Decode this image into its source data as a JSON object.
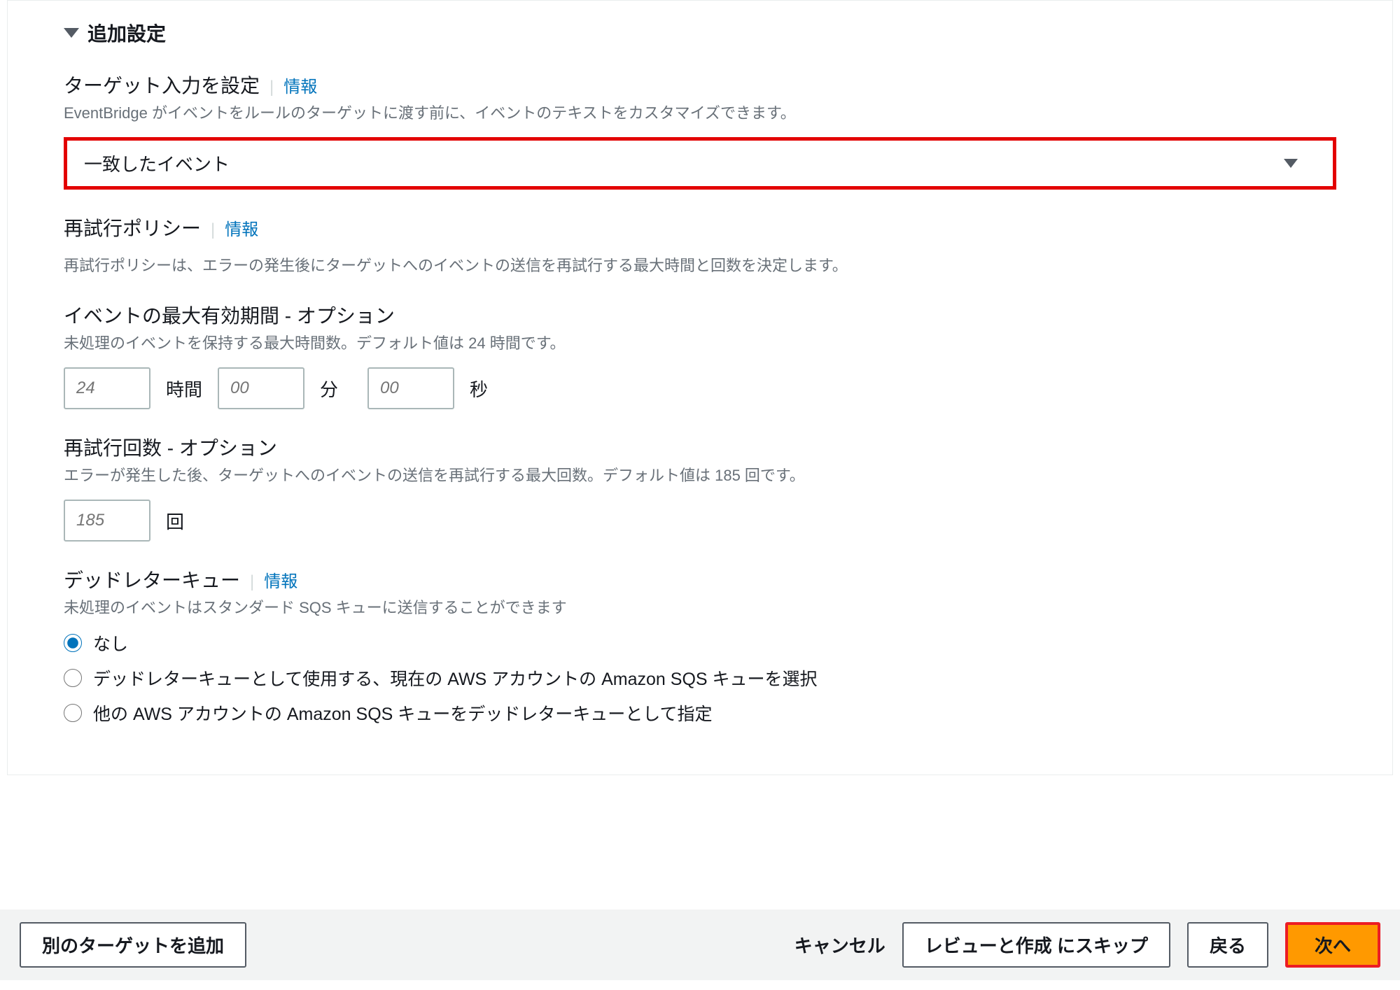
{
  "section": {
    "title": "追加設定"
  },
  "targetInput": {
    "title": "ターゲット入力を設定",
    "info": "情報",
    "desc": "EventBridge がイベントをルールのターゲットに渡す前に、イベントのテキストをカスタマイズできます。",
    "selectValue": "一致したイベント"
  },
  "retryPolicy": {
    "title": "再試行ポリシー",
    "info": "情報",
    "desc": "再試行ポリシーは、エラーの発生後にターゲットへのイベントの送信を再試行する最大時間と回数を決定します。"
  },
  "maxAge": {
    "title": "イベントの最大有効期間 - オプション",
    "desc": "未処理のイベントを保持する最大時間数。デフォルト値は 24 時間です。",
    "hoursPlaceholder": "24",
    "hoursUnit": "時間",
    "minutesPlaceholder": "00",
    "minutesUnit": "分",
    "secondsPlaceholder": "00",
    "secondsUnit": "秒"
  },
  "retryCount": {
    "title": "再試行回数 - オプション",
    "desc": "エラーが発生した後、ターゲットへのイベントの送信を再試行する最大回数。デフォルト値は 185 回です。",
    "placeholder": "185",
    "unit": "回"
  },
  "dlq": {
    "title": "デッドレターキュー",
    "info": "情報",
    "desc": "未処理のイベントはスタンダード SQS キューに送信することができます",
    "options": {
      "none": "なし",
      "current": "デッドレターキューとして使用する、現在の AWS アカウントの Amazon SQS キューを選択",
      "other": "他の AWS アカウントの Amazon SQS キューをデッドレターキューとして指定"
    }
  },
  "footer": {
    "addTarget": "別のターゲットを追加",
    "cancel": "キャンセル",
    "skip": "レビューと作成 にスキップ",
    "back": "戻る",
    "next": "次へ"
  }
}
